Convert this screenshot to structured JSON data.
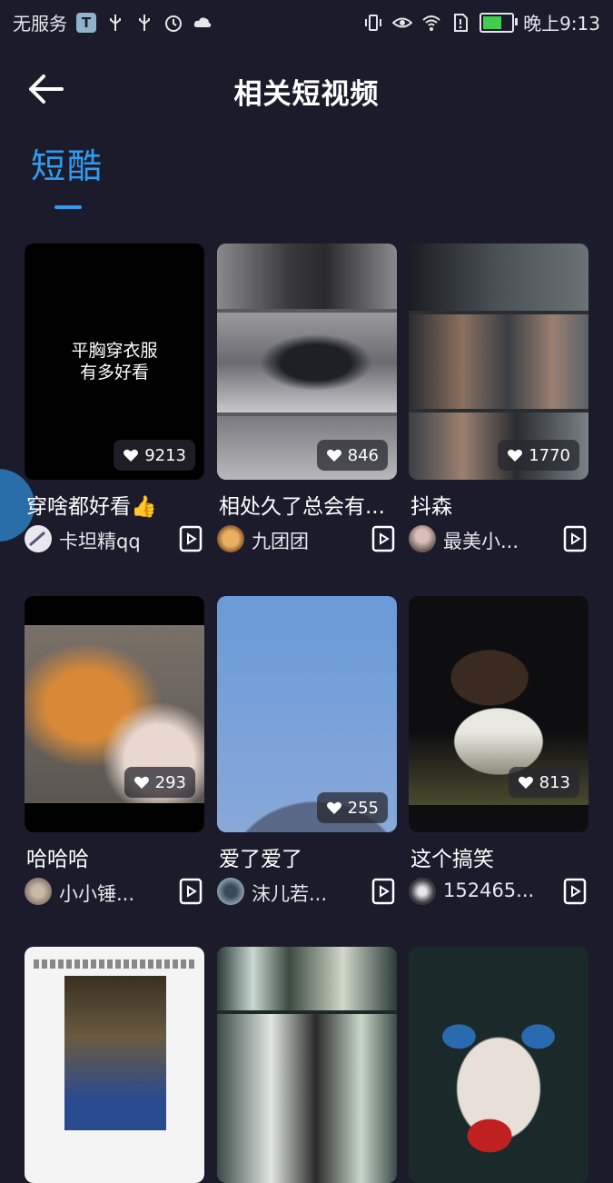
{
  "status": {
    "carrier": "无服务",
    "time": "晚上9:13"
  },
  "header": {
    "title": "相关短视频"
  },
  "tabs": [
    {
      "label": "短酷"
    }
  ],
  "videos": [
    {
      "title": "穿啥都好看👍",
      "overlay_line1": "平胸穿衣服",
      "overlay_line2": "有多好看",
      "likes": "9213",
      "author": "卡坦精qq"
    },
    {
      "title": "相处久了总会有...",
      "likes": "846",
      "author": "九团团"
    },
    {
      "title": "抖森",
      "likes": "1770",
      "author": "最美小..."
    },
    {
      "title": "哈哈哈",
      "likes": "293",
      "author": "小小锤..."
    },
    {
      "title": "爱了爱了",
      "likes": "255",
      "author": "沫儿若..."
    },
    {
      "title": "这个搞笑",
      "likes": "813",
      "author": "152465..."
    },
    {
      "title": ""
    },
    {
      "title": ""
    },
    {
      "title": ""
    }
  ],
  "colors": {
    "accent": "#2f9cf1",
    "background": "#1c1b2b"
  }
}
